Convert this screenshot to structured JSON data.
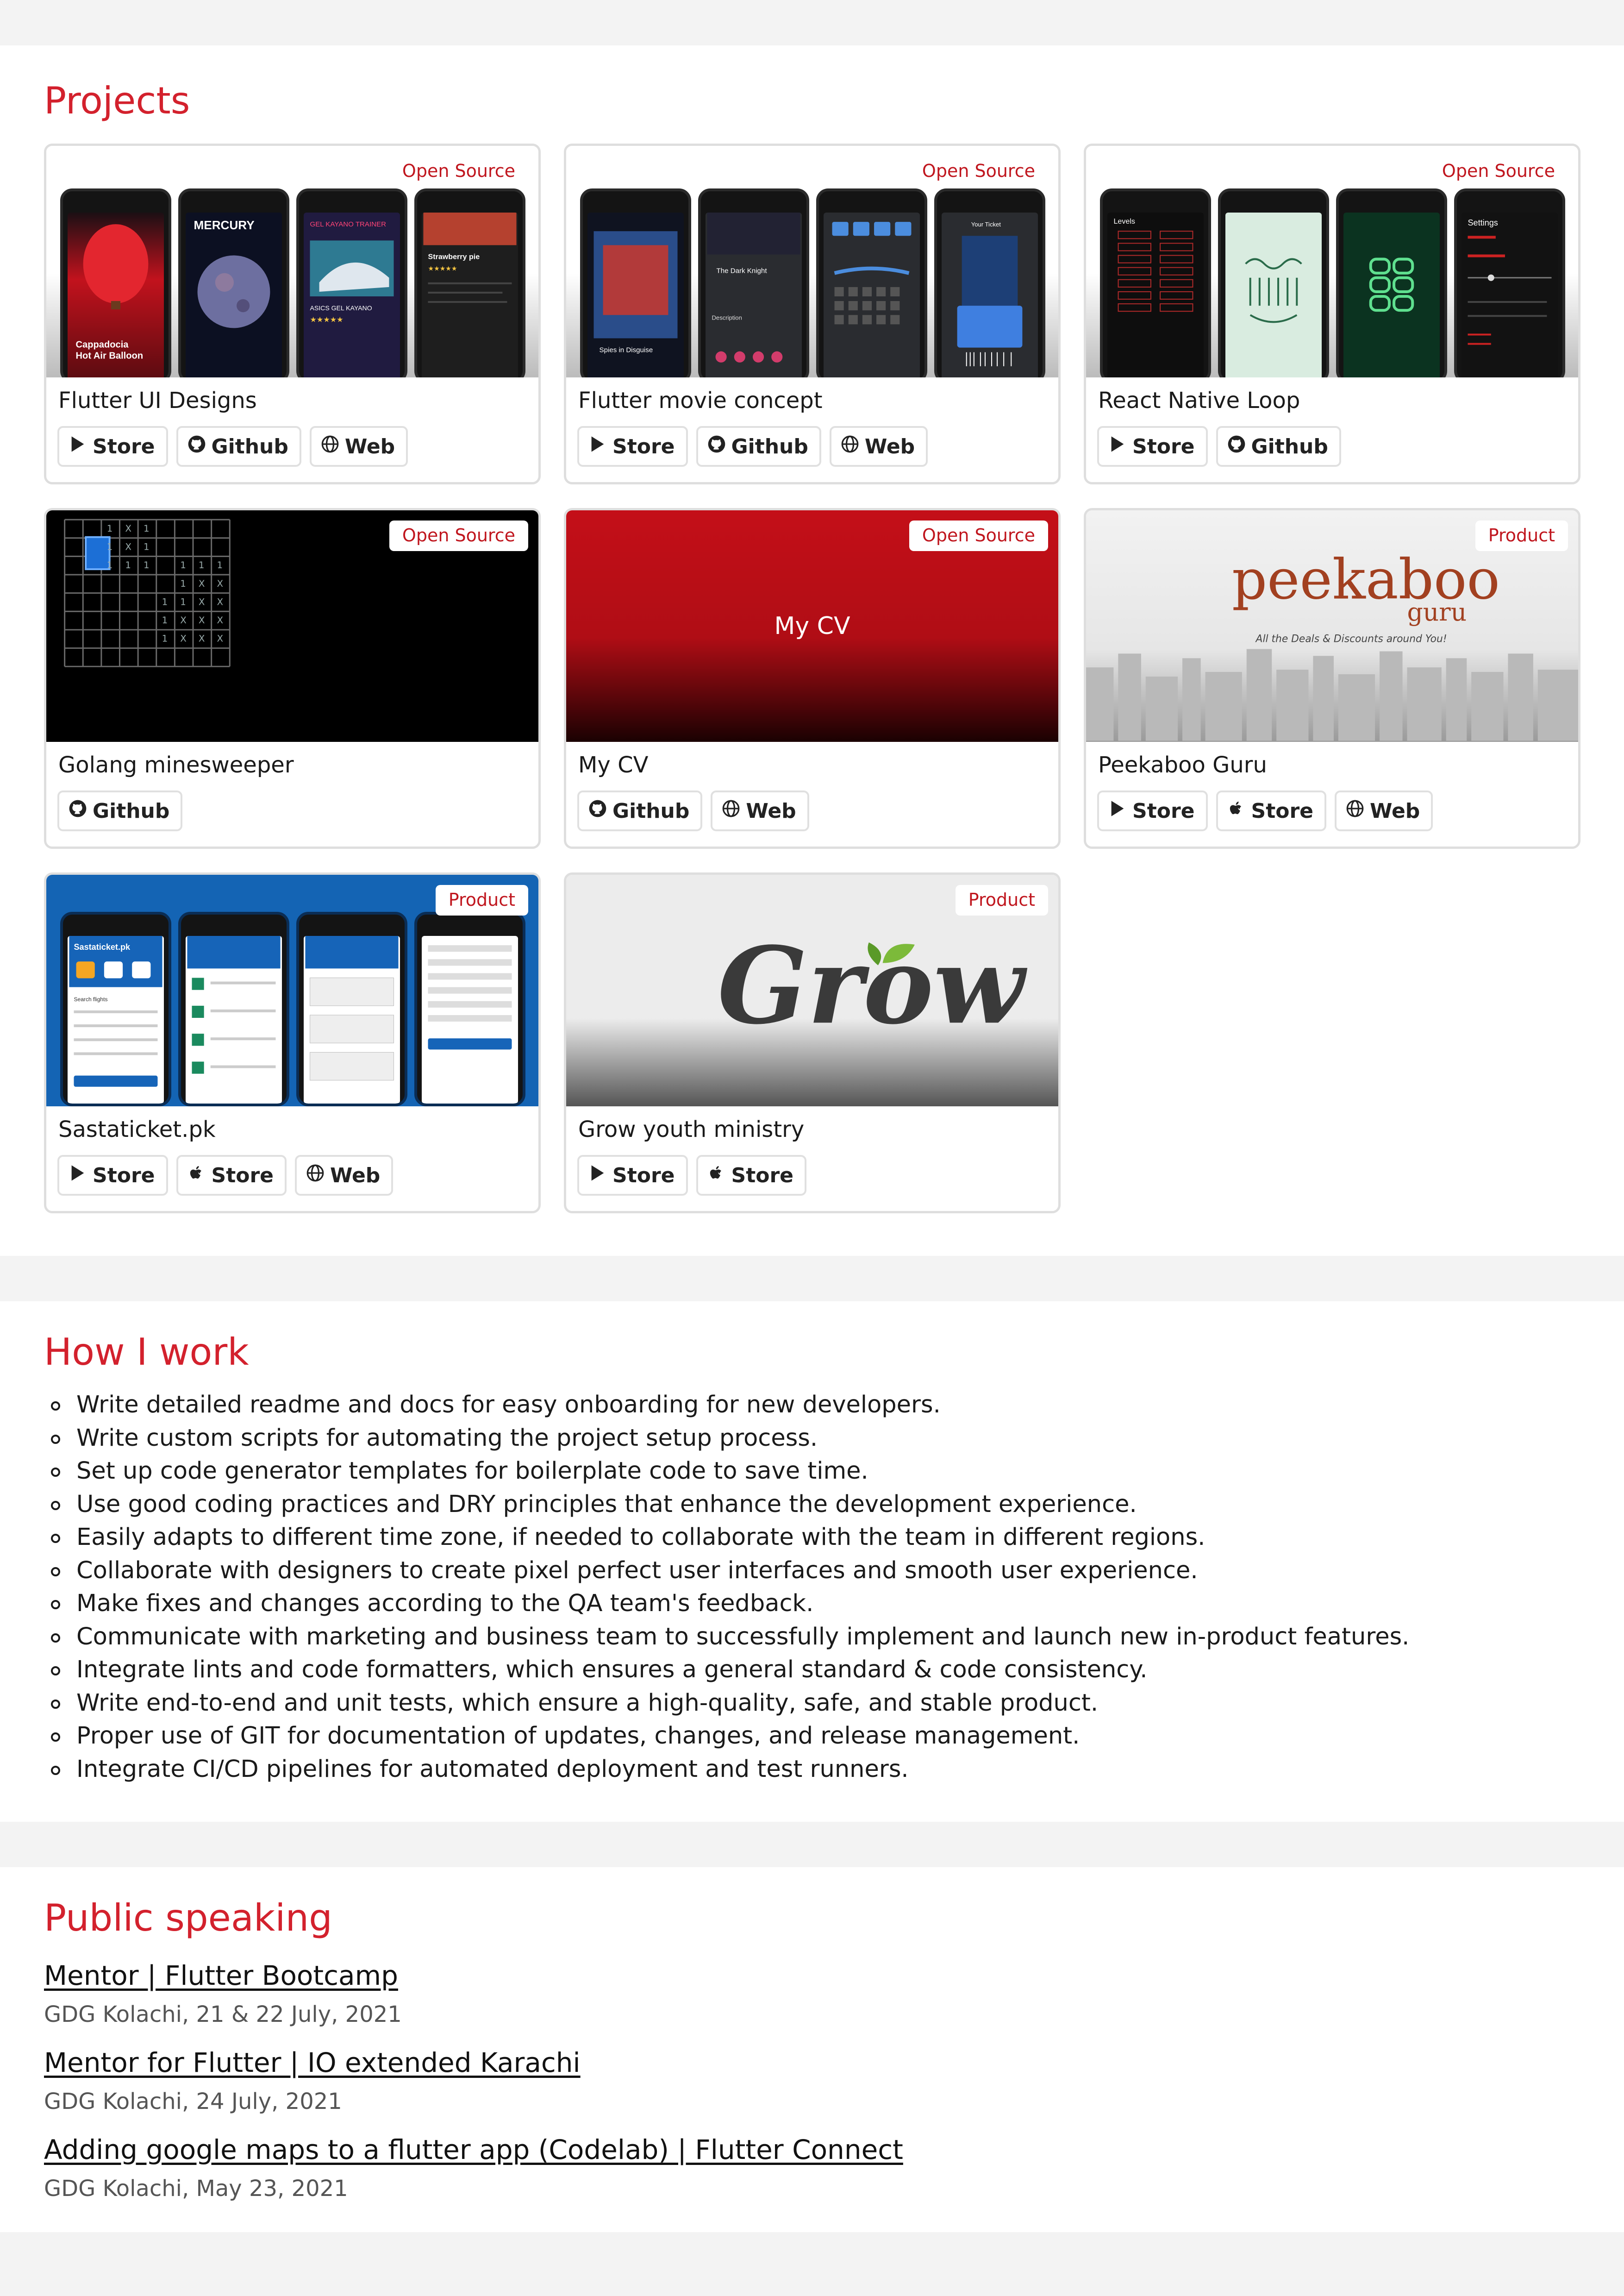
{
  "colors": {
    "accent": "#d3212d",
    "badge_text": "#c0161e",
    "card_border": "#dedede"
  },
  "projects": {
    "title": "Projects",
    "cards": [
      {
        "title": "Flutter UI Designs",
        "badge": "Open Source",
        "buttons": [
          {
            "icon": "play-store-icon",
            "label": "Store"
          },
          {
            "icon": "github-icon",
            "label": "Github"
          },
          {
            "icon": "globe-icon",
            "label": "Web"
          }
        ],
        "thumb_text": [
          "Cappadocia",
          "Hot Air Balloon",
          "MERCURY",
          "GEL KAYANO TRAINER",
          "ASICS GEL KAYANO",
          "Strawberry pie"
        ]
      },
      {
        "title": "Flutter movie concept",
        "badge": "Open Source",
        "buttons": [
          {
            "icon": "play-store-icon",
            "label": "Store"
          },
          {
            "icon": "github-icon",
            "label": "Github"
          },
          {
            "icon": "globe-icon",
            "label": "Web"
          }
        ],
        "thumb_text": [
          "The Dark Knight",
          "Description",
          "Your Ticket",
          "Spies in Disguise"
        ]
      },
      {
        "title": "React Native Loop",
        "badge": "Open Source",
        "buttons": [
          {
            "icon": "play-store-icon",
            "label": "Store"
          },
          {
            "icon": "github-icon",
            "label": "Github"
          }
        ],
        "thumb_text": [
          "Levels",
          "Settings"
        ]
      },
      {
        "title": "Golang minesweeper",
        "badge": "Open Source",
        "buttons": [
          {
            "icon": "github-icon",
            "label": "Github"
          }
        ]
      },
      {
        "title": "My CV",
        "badge": "Open Source",
        "thumb_label": "My CV",
        "buttons": [
          {
            "icon": "github-icon",
            "label": "Github"
          },
          {
            "icon": "globe-icon",
            "label": "Web"
          }
        ]
      },
      {
        "title": "Peekaboo Guru",
        "badge": "Product",
        "logo_word": "peekaboo",
        "logo_sub": "guru",
        "logo_tagline": "All the Deals & Discounts around You!",
        "buttons": [
          {
            "icon": "play-store-icon",
            "label": "Store"
          },
          {
            "icon": "apple-icon",
            "label": "Store"
          },
          {
            "icon": "globe-icon",
            "label": "Web"
          }
        ]
      },
      {
        "title": "Sastaticket.pk",
        "badge": "Product",
        "thumb_text": [
          "Sastaticket.pk",
          "Search flights"
        ],
        "buttons": [
          {
            "icon": "play-store-icon",
            "label": "Store"
          },
          {
            "icon": "apple-icon",
            "label": "Store"
          },
          {
            "icon": "globe-icon",
            "label": "Web"
          }
        ]
      },
      {
        "title": "Grow youth ministry",
        "badge": "Product",
        "logo_word": "Grow",
        "buttons": [
          {
            "icon": "play-store-icon",
            "label": "Store"
          },
          {
            "icon": "apple-icon",
            "label": "Store"
          }
        ]
      }
    ]
  },
  "how_i_work": {
    "title": "How I work",
    "items": [
      "Write detailed readme and docs for easy onboarding for new developers.",
      "Write custom scripts for automating the project setup process.",
      "Set up code generator templates for boilerplate code to save time.",
      "Use good coding practices and DRY principles that enhance the development experience.",
      "Easily adapts to different time zone, if needed to collaborate with the team in different regions.",
      "Collaborate with designers to create pixel perfect user interfaces and smooth user experience.",
      "Make fixes and changes according to the QA team's feedback.",
      "Communicate with marketing and business team to successfully implement and launch new in-product features.",
      "Integrate lints and code formatters, which ensures a general standard & code consistency.",
      "Write end-to-end and unit tests, which ensure a high-quality, safe, and stable product.",
      "Proper use of GIT for documentation of updates, changes, and release management.",
      "Integrate CI/CD pipelines for automated deployment and test runners."
    ]
  },
  "public_speaking": {
    "title": "Public speaking",
    "talks": [
      {
        "title": "Mentor | Flutter Bootcamp",
        "meta": "GDG Kolachi, 21 & 22 July, 2021"
      },
      {
        "title": "Mentor for Flutter | IO extended Karachi",
        "meta": "GDG Kolachi, 24 July, 2021"
      },
      {
        "title": "Adding google maps to a flutter app (Codelab) | Flutter Connect",
        "meta": "GDG Kolachi, May 23, 2021"
      }
    ]
  }
}
